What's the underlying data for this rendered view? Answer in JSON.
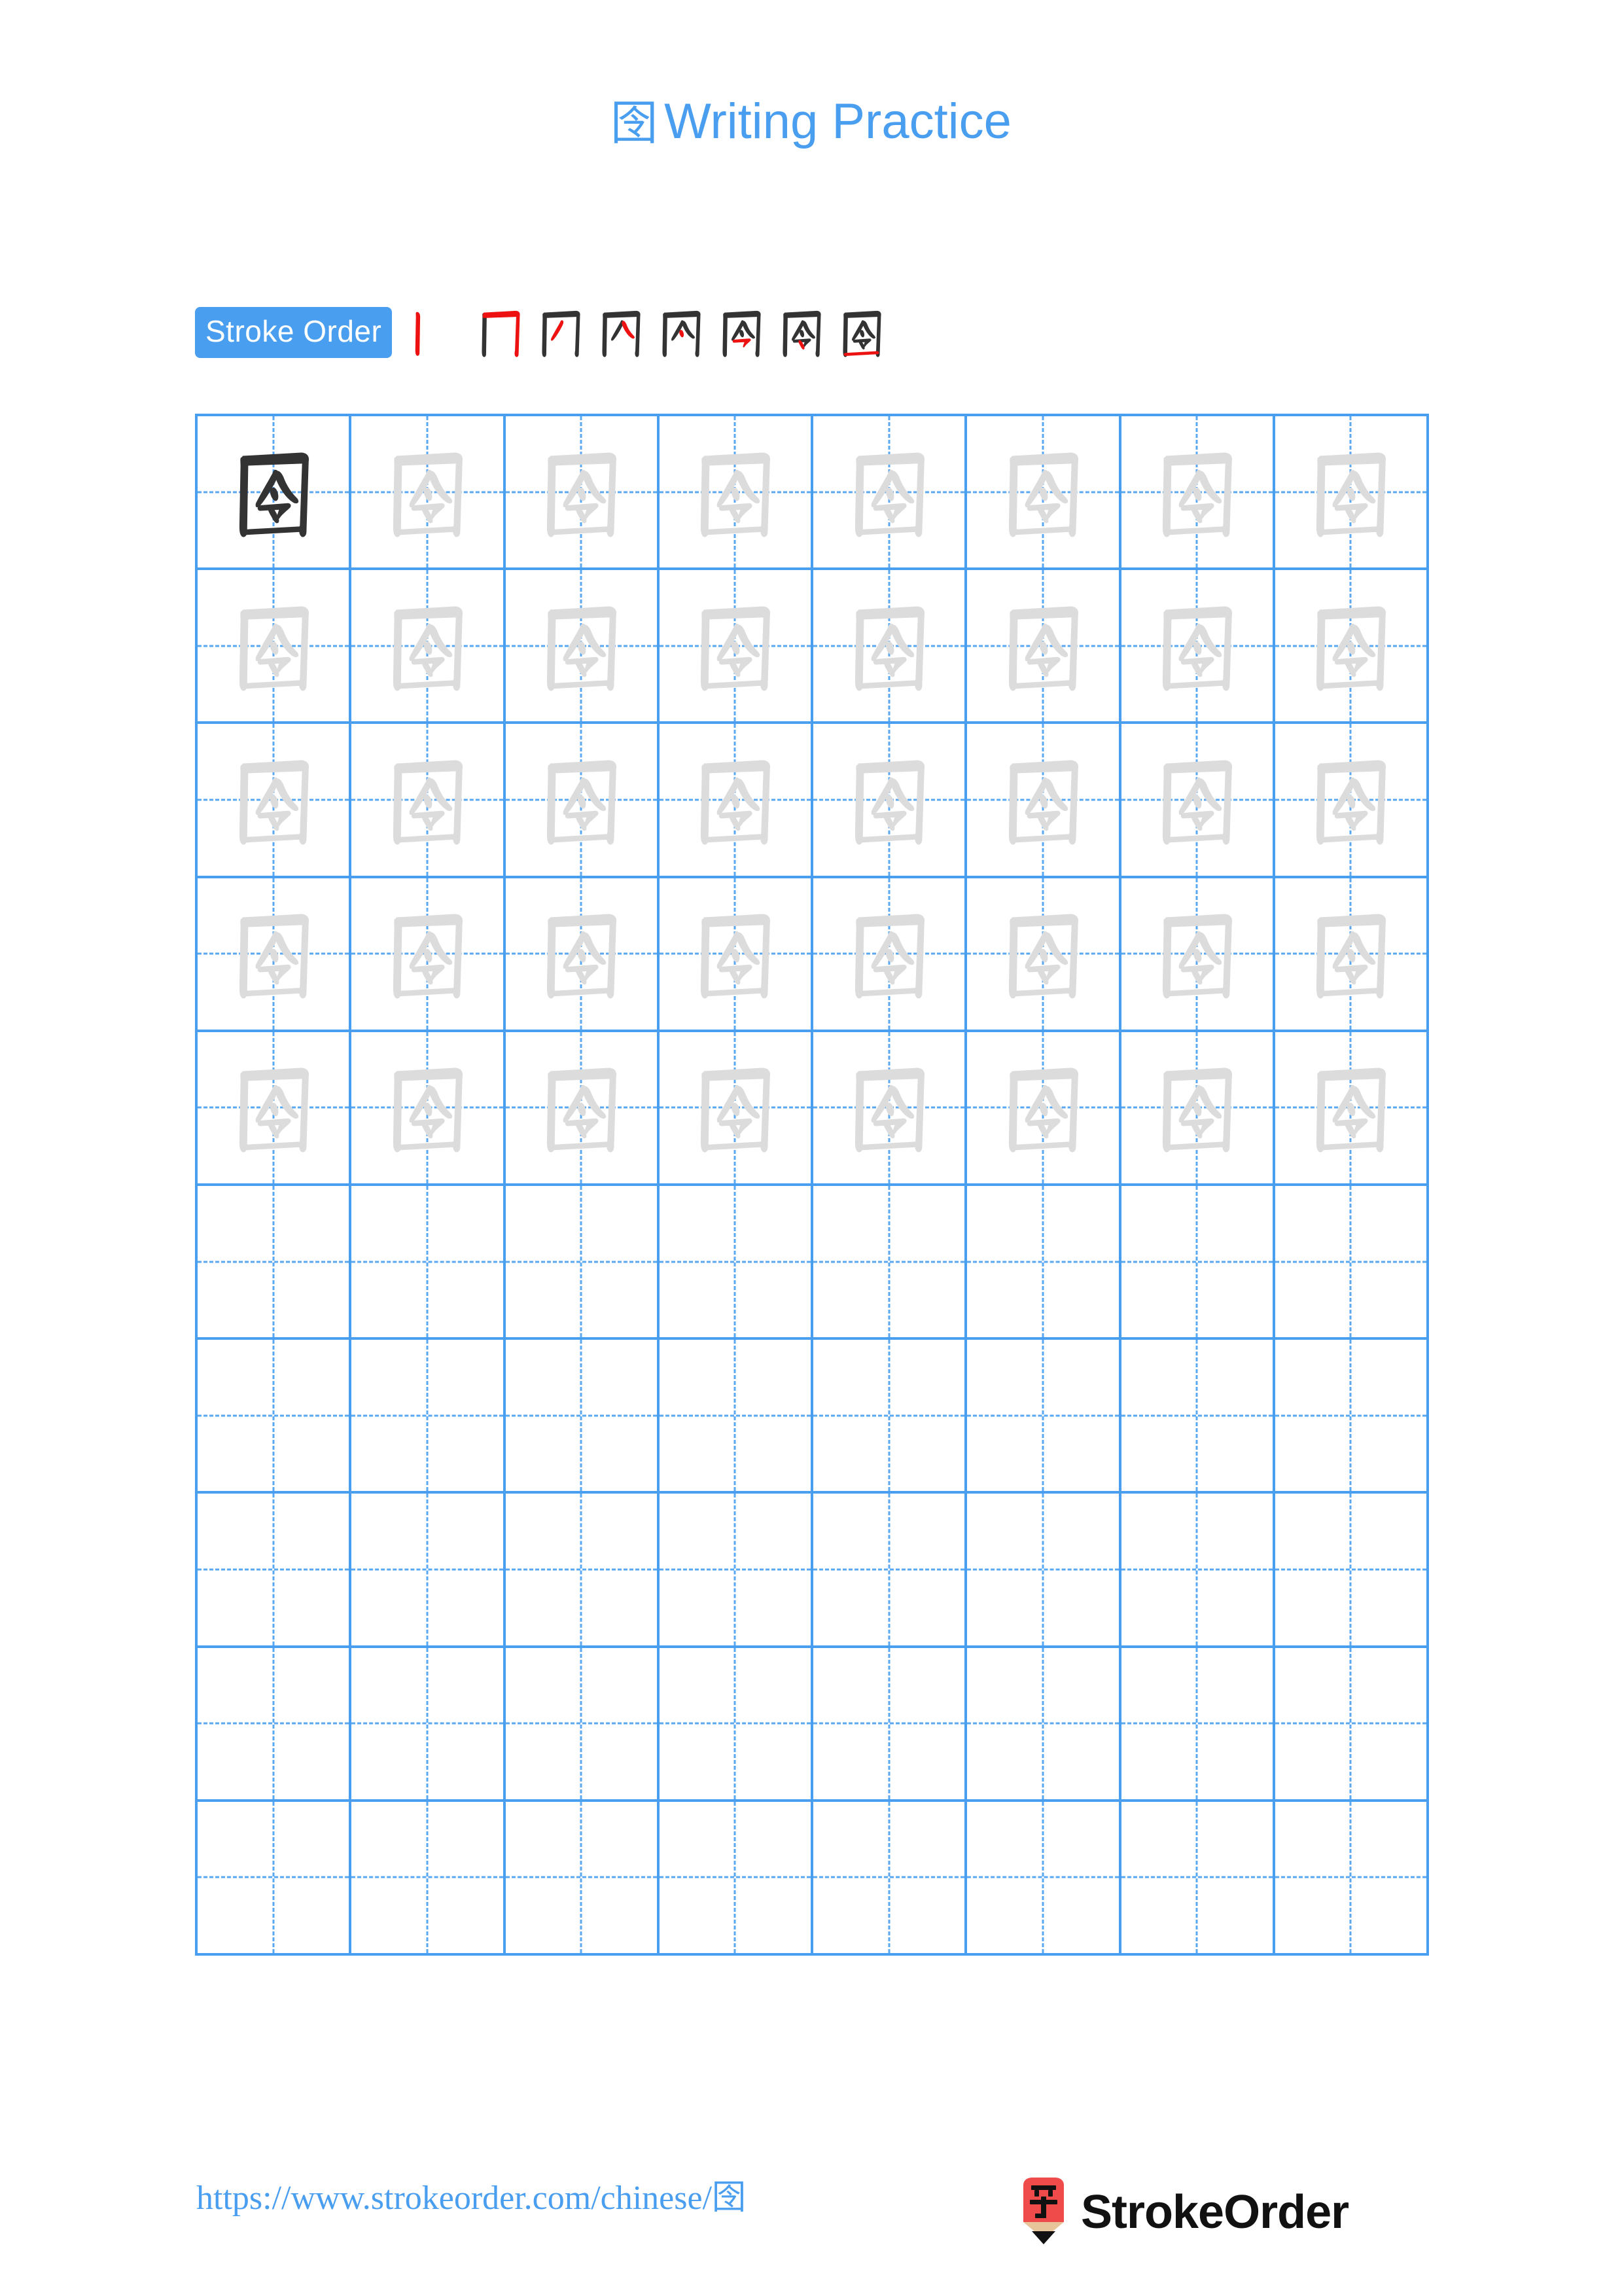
{
  "page": {
    "character": "囹",
    "title_suffix": "Writing Practice",
    "background_color": "#ffffff"
  },
  "colors": {
    "accent_blue": "#4a9ef0",
    "grid_line": "#4a9ef0",
    "guide_dash": "#5aa7f2",
    "trace_gray": "#dcdcdc",
    "ink_dark": "#333333",
    "new_stroke_red": "#ee1111",
    "logo_red": "#ef4b4b",
    "logo_wood": "#e8c49a",
    "brand_text": "#111111"
  },
  "header": {
    "title_char": "囹",
    "title_text": "Writing Practice"
  },
  "stroke_order": {
    "badge_label": "Stroke Order",
    "total_strokes": 8,
    "steps": [
      {
        "index": 1,
        "name": "stroke-step-1",
        "new_stroke": "vertical-left"
      },
      {
        "index": 2,
        "name": "stroke-step-2",
        "new_stroke": "horizontal-top-with-right-vertical"
      },
      {
        "index": 3,
        "name": "stroke-step-3",
        "new_stroke": "ling-left-falling"
      },
      {
        "index": 4,
        "name": "stroke-step-4",
        "new_stroke": "ling-right-falling"
      },
      {
        "index": 5,
        "name": "stroke-step-5",
        "new_stroke": "ling-dot"
      },
      {
        "index": 6,
        "name": "stroke-step-6",
        "new_stroke": "horizontal-hook"
      },
      {
        "index": 7,
        "name": "stroke-step-7",
        "new_stroke": "ling-dot-lower"
      },
      {
        "index": 8,
        "name": "stroke-step-8",
        "new_stroke": "horizontal-bottom-close"
      }
    ]
  },
  "grid": {
    "columns": 8,
    "rows": 10,
    "traced_rows": 5,
    "solid_cells": 1,
    "cell_states": [
      [
        "solid",
        "trace",
        "trace",
        "trace",
        "trace",
        "trace",
        "trace",
        "trace"
      ],
      [
        "trace",
        "trace",
        "trace",
        "trace",
        "trace",
        "trace",
        "trace",
        "trace"
      ],
      [
        "trace",
        "trace",
        "trace",
        "trace",
        "trace",
        "trace",
        "trace",
        "trace"
      ],
      [
        "trace",
        "trace",
        "trace",
        "trace",
        "trace",
        "trace",
        "trace",
        "trace"
      ],
      [
        "trace",
        "trace",
        "trace",
        "trace",
        "trace",
        "trace",
        "trace",
        "trace"
      ],
      [
        "empty",
        "empty",
        "empty",
        "empty",
        "empty",
        "empty",
        "empty",
        "empty"
      ],
      [
        "empty",
        "empty",
        "empty",
        "empty",
        "empty",
        "empty",
        "empty",
        "empty"
      ],
      [
        "empty",
        "empty",
        "empty",
        "empty",
        "empty",
        "empty",
        "empty",
        "empty"
      ],
      [
        "empty",
        "empty",
        "empty",
        "empty",
        "empty",
        "empty",
        "empty",
        "empty"
      ],
      [
        "empty",
        "empty",
        "empty",
        "empty",
        "empty",
        "empty",
        "empty",
        "empty"
      ]
    ]
  },
  "footer": {
    "url_text": "https://www.strokeorder.com/chinese/",
    "url_char": "囹",
    "brand_name": "StrokeOrder",
    "logo_char": "字"
  }
}
